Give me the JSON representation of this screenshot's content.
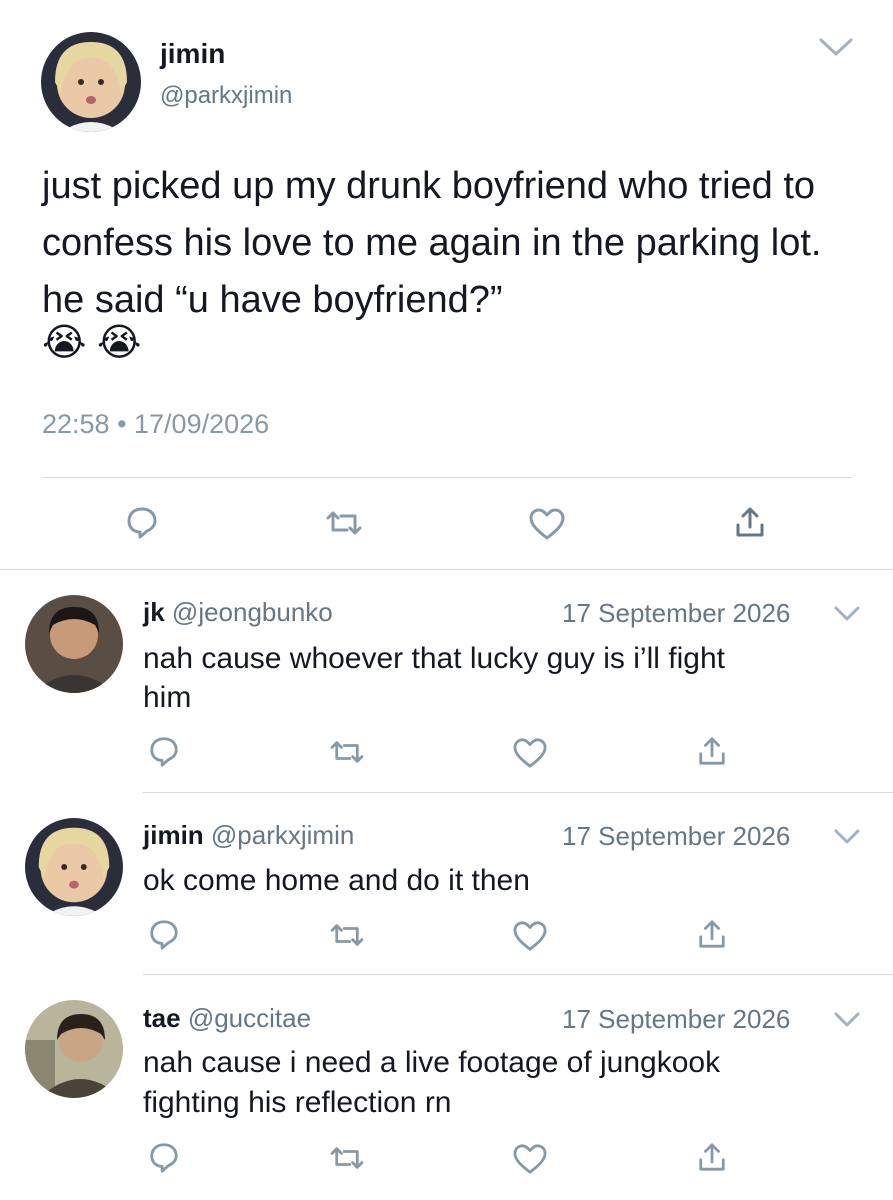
{
  "main_tweet": {
    "display_name": "jimin",
    "handle": "@parkxjimin",
    "text": "just picked up my drunk boyfriend who tried to confess his love to me again in the parking lot. he said “u have boyfriend?”",
    "emojis": [
      "😭",
      "😭"
    ],
    "timestamp": "22:58 • 17/09/2026",
    "avatar_icon": "avatar-photo-blonde",
    "actions": [
      "reply-icon",
      "retweet-icon",
      "like-icon",
      "share-icon"
    ]
  },
  "replies": [
    {
      "display_name": "jk",
      "handle": "@jeongbunko",
      "date": "17 September 2026",
      "text_line1": "nah cause whoever that lucky guy is i’ll fight",
      "text_line2": "him"
    },
    {
      "display_name": "jimin",
      "handle": "@parkxjimin",
      "date": "17 September 2026",
      "text_line1": "ok come home and do it then",
      "text_line2": ""
    },
    {
      "display_name": "tae",
      "handle": "@guccitae",
      "date": "17 September 2026",
      "text_line1": "nah cause i need a live footage of jungkook",
      "text_line2": "fighting his reflection rn"
    }
  ],
  "colors": {
    "text": "#141823",
    "secondary": "#657786",
    "icon": "#8899a6",
    "divider": "#d8dde2"
  }
}
